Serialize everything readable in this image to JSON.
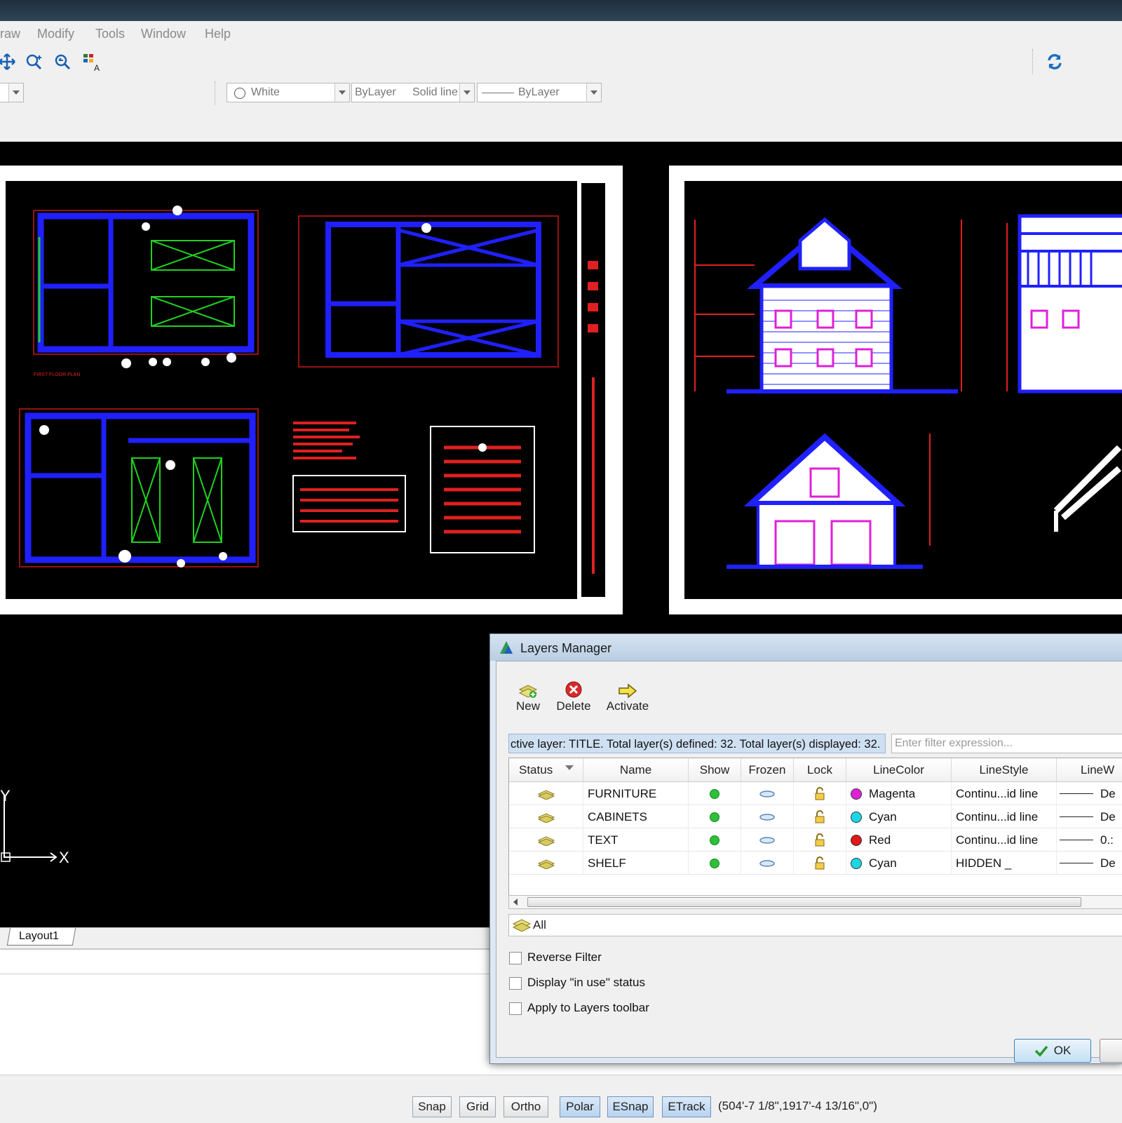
{
  "menu": {
    "items": [
      "raw",
      "Modify",
      "Tools",
      "Window",
      "Help"
    ]
  },
  "toolbar2": {
    "color_value": "White",
    "linetype_value": "ByLayer",
    "linetype_desc": "Solid line",
    "lineweight_value": "ByLayer"
  },
  "layout_tab": "Layout1",
  "ucs": {
    "x_label": "X",
    "y_label": "Y"
  },
  "status": {
    "buttons": [
      {
        "label": "Snap",
        "active": false
      },
      {
        "label": "Grid",
        "active": false
      },
      {
        "label": "Ortho",
        "active": false
      },
      {
        "label": "Polar",
        "active": true
      },
      {
        "label": "ESnap",
        "active": true
      },
      {
        "label": "ETrack",
        "active": true
      }
    ],
    "coordinates": "(504'-7 1/8\",1917'-4 13/16\",0\")"
  },
  "dialog": {
    "title": "Layers Manager",
    "toolbar": {
      "new": "New",
      "delete": "Delete",
      "activate": "Activate"
    },
    "info": "ctive layer: TITLE. Total layer(s) defined: 32. Total layer(s) displayed: 32.",
    "filter_placeholder": "Enter filter expression...",
    "columns": [
      "Status",
      "Name",
      "Show",
      "Frozen",
      "Lock",
      "LineColor",
      "LineStyle",
      "LineW"
    ],
    "rows": [
      {
        "name": "FURNITURE",
        "color": "Magenta",
        "color_hex": "#e020d8",
        "linestyle": "Continu...id line",
        "lineweight": "De"
      },
      {
        "name": "CABINETS",
        "color": "Cyan",
        "color_hex": "#18d8e8",
        "linestyle": "Continu...id line",
        "lineweight": "De"
      },
      {
        "name": "TEXT",
        "color": "Red",
        "color_hex": "#e01818",
        "linestyle": "Continu...id line",
        "lineweight": "0.:"
      },
      {
        "name": "SHELF",
        "color": "Cyan",
        "color_hex": "#18d8e8",
        "linestyle": "HIDDEN _",
        "lineweight": "De"
      }
    ],
    "filter_all": "All",
    "options": {
      "reverse": "Reverse Filter",
      "in_use": "Display \"in use\" status",
      "apply": "Apply to Layers toolbar"
    },
    "ok": "OK"
  }
}
